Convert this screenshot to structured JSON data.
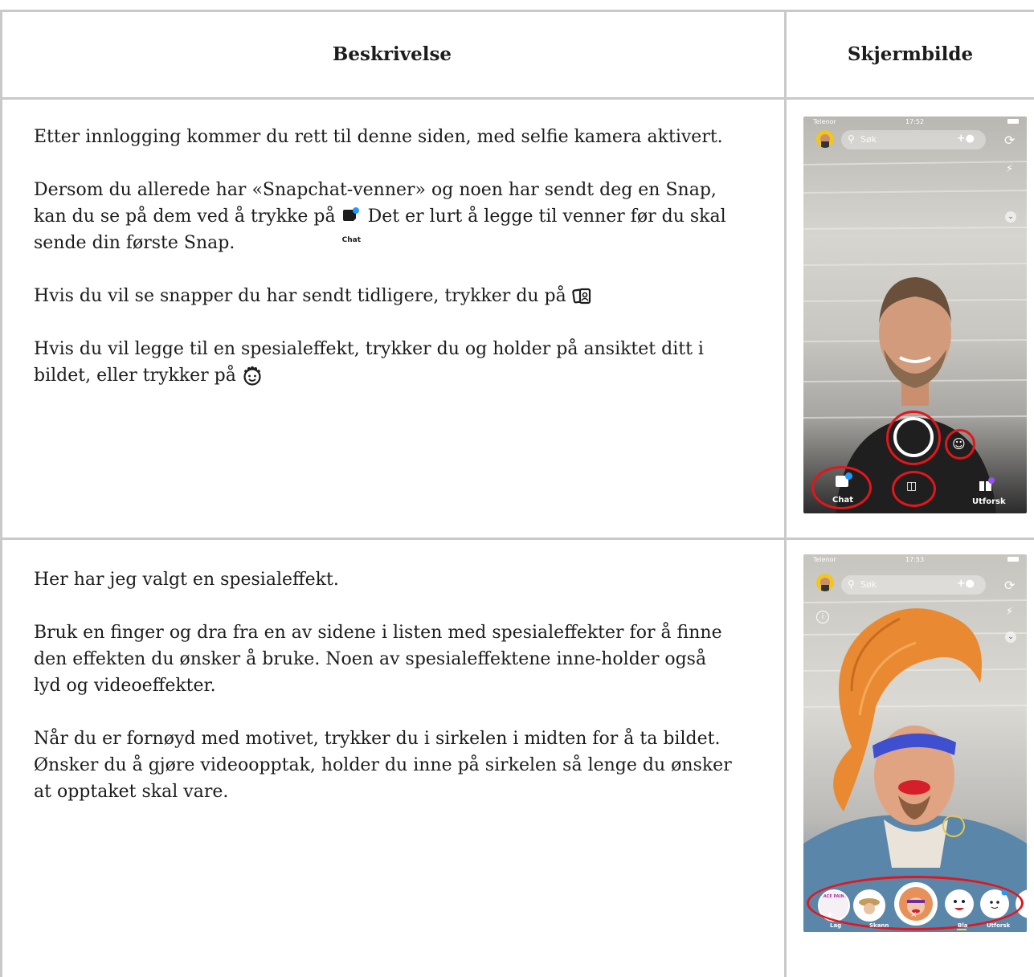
{
  "header": {
    "col1": "Beskrivelse",
    "col2": "Skjermbilde"
  },
  "row1": {
    "p1": "Etter innlogging kommer du rett til denne siden, med selfie kamera aktivert.",
    "p2_a": "Dersom du allerede har «Snapchat-venner» og noen har sendt deg en Snap, kan du se på dem ved å trykke på",
    "p2_icon_label": "Chat",
    "p2_b": "Det er lurt å legge til venner før du skal sende din første Snap.",
    "p3": "Hvis du vil se snapper du har sendt tidligere, trykker du på",
    "p4": "Hvis du vil legge til en spesialeffekt, trykker du og holder på ansiktet ditt i bildet, eller trykker på",
    "phone": {
      "carrier": "Telenor",
      "time": "17:52",
      "search": "Søk",
      "chat_label": "Chat",
      "explore_label": "Utforsk"
    }
  },
  "row2": {
    "p1": "Her har jeg valgt en spesialeffekt.",
    "p2": "Bruk en finger og dra fra en av sidene i listen med spesialeffekter for å finne den effekten du ønsker å bruke. Noen av spesialeffektene inne-holder også lyd og videoeffekter.",
    "p3": "Når du er fornøyd med motivet, trykker du i sirkelen i midten for å ta bildet. Ønsker du å gjøre videoopptak, holder du inne på sirkelen så lenge du ønsker at opptaket skal vare.",
    "phone": {
      "carrier": "Telenor",
      "time": "17:53",
      "search": "Søk",
      "lens_banner": "FACE PAINT",
      "nav": [
        "Lag",
        "Skann",
        "Bla",
        "Utforsk"
      ]
    }
  },
  "colors": {
    "grid": "#c9c9c9",
    "highlight": "#e3161b",
    "avatar": "#f2c61f",
    "notification": "#1e9bff"
  }
}
